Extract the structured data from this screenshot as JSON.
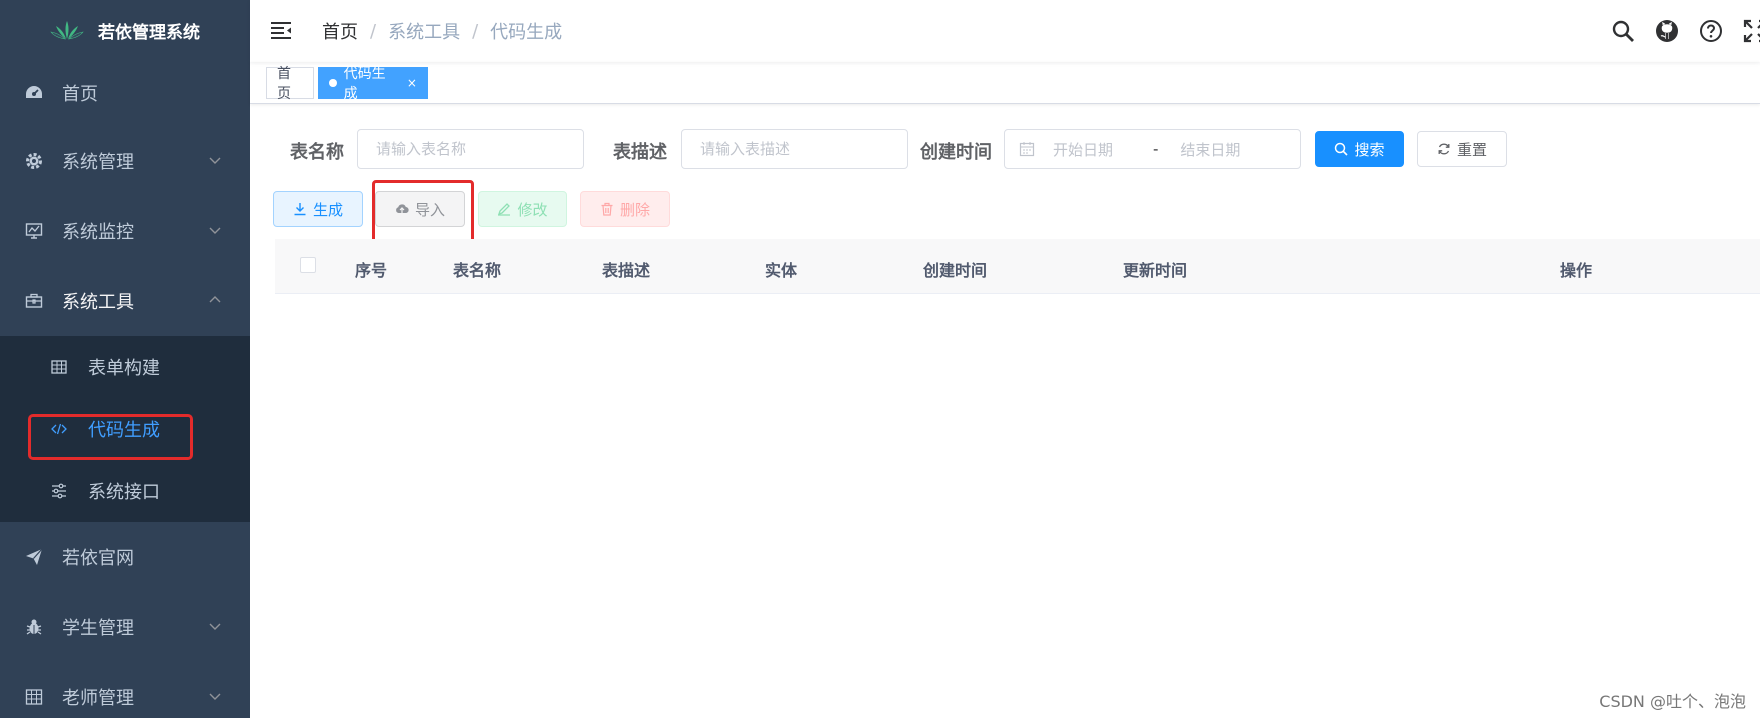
{
  "app": {
    "title": "若依管理系统"
  },
  "sidebar": {
    "items": [
      {
        "label": "首页",
        "icon": "dashboard-icon"
      },
      {
        "label": "系统管理",
        "icon": "gear-icon",
        "expandable": true
      },
      {
        "label": "系统监控",
        "icon": "monitor-icon",
        "expandable": true
      },
      {
        "label": "系统工具",
        "icon": "toolbox-icon",
        "expandable": true,
        "expanded": true,
        "children": [
          {
            "label": "表单构建",
            "icon": "table-icon"
          },
          {
            "label": "代码生成",
            "icon": "code-icon",
            "active": true
          },
          {
            "label": "系统接口",
            "icon": "sliders-icon"
          }
        ]
      },
      {
        "label": "若依官网",
        "icon": "send-icon"
      },
      {
        "label": "学生管理",
        "icon": "bug-icon",
        "expandable": true
      },
      {
        "label": "老师管理",
        "icon": "grid-icon",
        "expandable": true
      }
    ]
  },
  "navbar": {
    "breadcrumb": [
      "首页",
      "系统工具",
      "代码生成"
    ],
    "separator": "/"
  },
  "tags": [
    {
      "label": "首页",
      "active": false
    },
    {
      "label": "代码生成",
      "active": true,
      "close": "×"
    }
  ],
  "search": {
    "table_name_label": "表名称",
    "table_name_placeholder": "请输入表名称",
    "table_desc_label": "表描述",
    "table_desc_placeholder": "请输入表描述",
    "create_time_label": "创建时间",
    "start_placeholder": "开始日期",
    "range_separator": "-",
    "end_placeholder": "结束日期",
    "search_button": "搜索",
    "reset_button": "重置"
  },
  "toolbar": {
    "generate": "生成",
    "import": "导入",
    "edit": "修改",
    "delete": "删除"
  },
  "table": {
    "columns": [
      "序号",
      "表名称",
      "表描述",
      "实体",
      "创建时间",
      "更新时间",
      "操作"
    ],
    "rows": []
  },
  "watermark": "CSDN @吐个、泡泡",
  "colors": {
    "sidebar_bg": "#304156",
    "submenu_bg": "#1f2d3d",
    "primary": "#1890ff",
    "highlight": "#e32b2b"
  }
}
